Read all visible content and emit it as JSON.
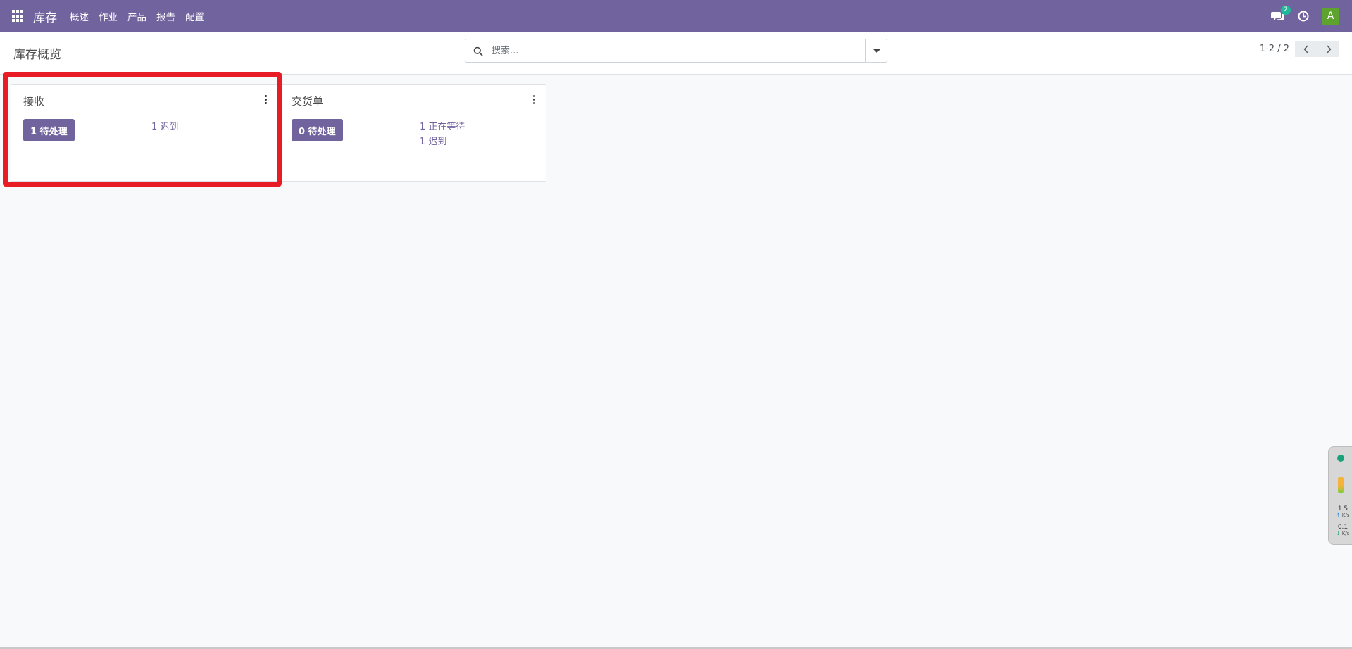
{
  "navbar": {
    "app_name": "库存",
    "menu": [
      "概述",
      "作业",
      "产品",
      "报告",
      "配置"
    ],
    "chat_count": "2",
    "avatar_letter": "A",
    "accent": "#71639e"
  },
  "control_panel": {
    "title": "库存概览",
    "search_placeholder": "搜索...",
    "pager": "1-2 / 2"
  },
  "cards": [
    {
      "title": "接收",
      "button_label": "1 待处理",
      "links": [
        "1 迟到"
      ]
    },
    {
      "title": "交货单",
      "button_label": "0 待处理",
      "links": [
        "1 正在等待",
        "1 迟到"
      ]
    }
  ],
  "net_widget": {
    "upload": "1.5",
    "download": "0.1",
    "unit": "K/s"
  },
  "highlight_color": "#e81c24"
}
